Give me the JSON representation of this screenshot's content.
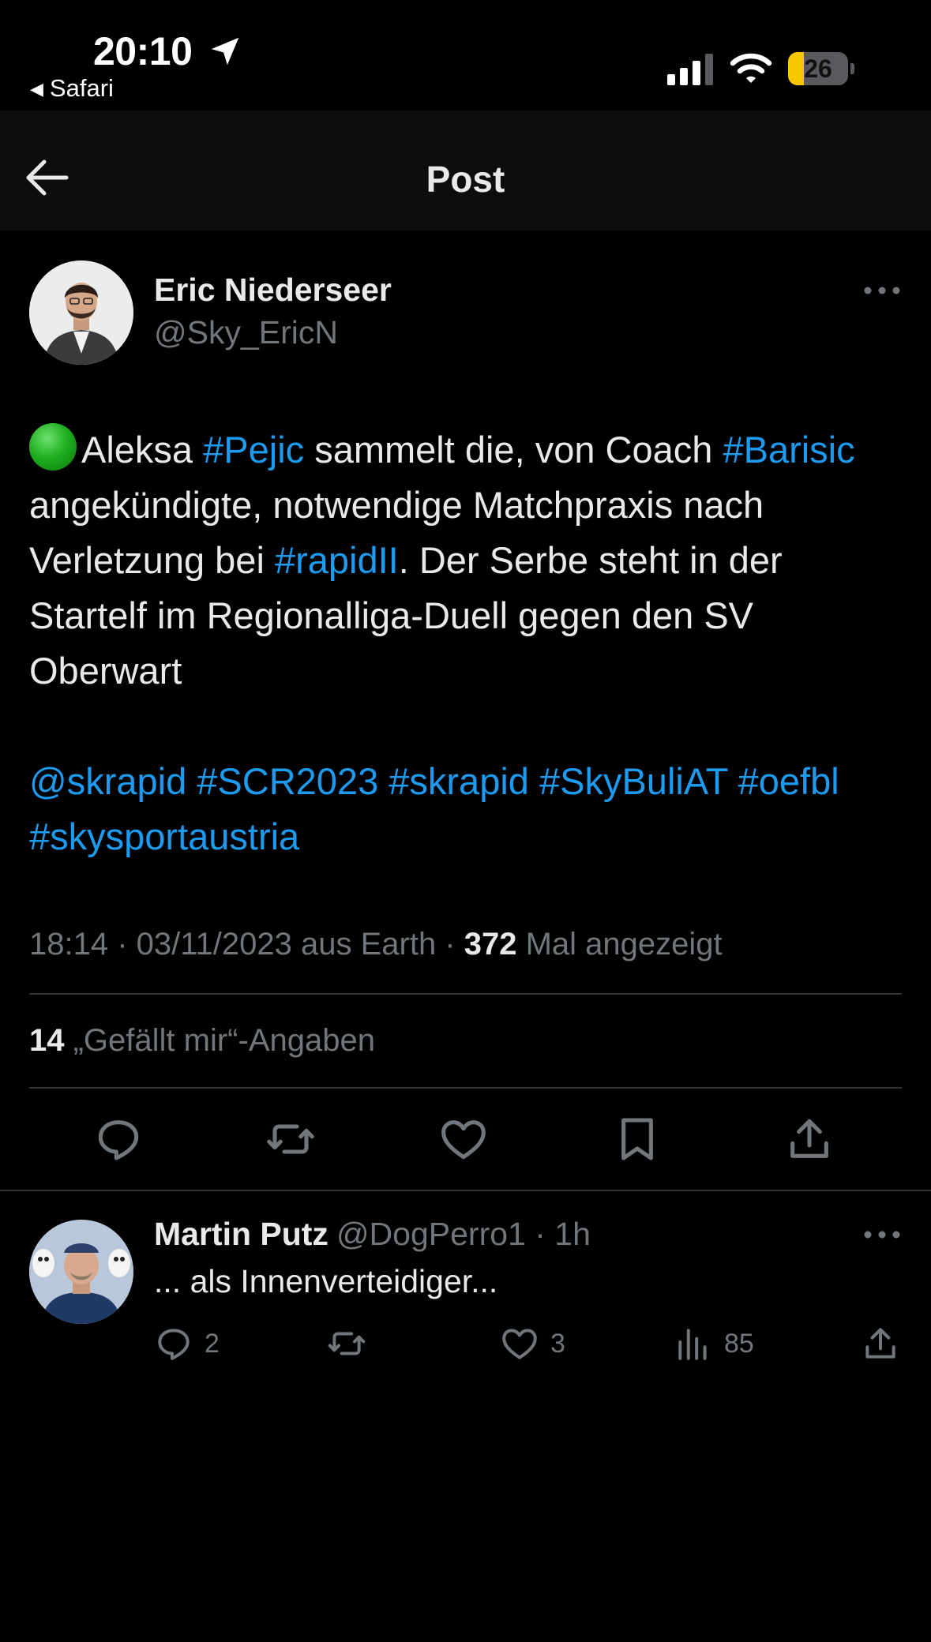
{
  "status_bar": {
    "time": "20:10",
    "back_app": "Safari",
    "battery_level": "26"
  },
  "nav": {
    "title": "Post"
  },
  "post": {
    "author_name": "Eric Niederseer",
    "author_handle": "@Sky_EricN",
    "text_parts": {
      "p1": "Aleksa ",
      "tag1": "#Pejic",
      "p2": " sammelt die, von Coach ",
      "tag2": "#Barisic",
      "p3": " angekündigte, notwendige Matchpraxis nach Verletzung bei ",
      "tag3": "#rapidII",
      "p4": ". Der Serbe steht in der Startelf im Regionalliga-Duell gegen den SV Oberwart",
      "tags_line": "@skrapid #SCR2023 #skrapid #SkyBuliAT #oefbl #skysportaustria"
    },
    "timestamp": "18:14 · 03/11/2023 aus Earth · ",
    "views_count": "372",
    "views_label": " Mal angezeigt",
    "likes_count": "14",
    "likes_label": " „Gefällt mir“-Angaben"
  },
  "reply": {
    "author_name": "Martin Putz",
    "handle_time": "@DogPerro1 · 1h",
    "text": "... als Innenverteidiger...",
    "reply_count": "2",
    "like_count": "3",
    "view_count": "85"
  },
  "colors": {
    "background": "#000000",
    "text": "#e7e9ea",
    "secondary": "#71767b",
    "link": "#1d9bf0",
    "divider": "#2f3336",
    "battery": "#f7c600"
  },
  "icons": {
    "back": "arrow-left-icon",
    "more": "more-horizontal-icon",
    "reply": "speech-bubble-icon",
    "retweet": "repost-icon",
    "like": "heart-icon",
    "bookmark": "bookmark-icon",
    "share": "share-icon",
    "views": "bar-chart-icon"
  }
}
